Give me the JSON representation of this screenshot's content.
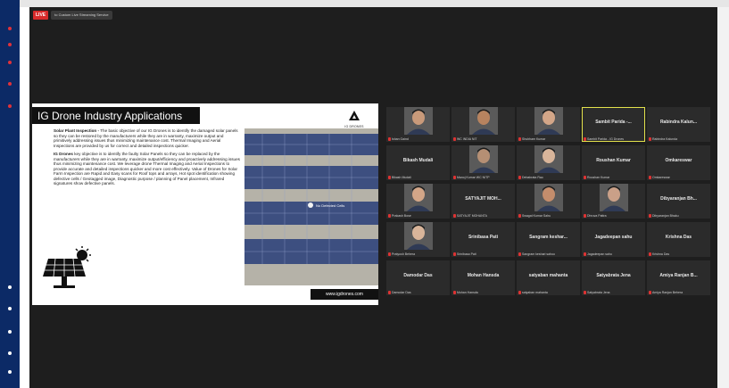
{
  "toolbar": {
    "live_badge": "LIVE",
    "stream_label": "to Custom Live Streaming Service"
  },
  "slide": {
    "title": "IG Drone Industry Applications",
    "logo_text": "IG DRONES",
    "para1_bold": "Solar Plant Inspection -",
    "para1_text": " The basic objective of our IG Drones is to identify the damaged solar panels so they can be restored by the manufacturers while they are in warranty, maximize output and primitively addressing issues thus minimizing maintenance cost. Thermal Imaging and Aerial Inspections are provided by us for correct and detailed inspections quicker.",
    "para2_bold": "IG Drones",
    "para2_text": " key objective is to identify the faulty Solar Panels so they can be replaced by the manufacturers while they are in warranty, maximize output/efficiency and proactively addressing issues thus minimizing maintenance cost. We leverage drone Thermal Imaging and Aerial Inspections to provide accurate and detailed inspections quicker and more cost effectively. Value of Drones for Solar Farm Inspection are Rapid and Easy scans for Roof tops and arrays, Hot spot identification showing defective cells / Geotagged image, Diagnostic purpose / planning of Panel placement, Infrared signatures show defective panels.",
    "image_caption": "No Defected Cells",
    "site_label": "www.igdrones.com"
  },
  "participants": [
    {
      "name": "",
      "label": "Ishan Gaind",
      "has_video": true
    },
    {
      "name": "",
      "label": "WC INDIA NIT",
      "has_video": true
    },
    {
      "name": "",
      "label": "Shubham Kumar",
      "has_video": true
    },
    {
      "name": "Sambit Parida -...",
      "label": "Sambit Parida - IG Drones",
      "has_video": false,
      "active": true
    },
    {
      "name": "Rabindra Kalun...",
      "label": "Rabindra Kalunda",
      "has_video": false
    },
    {
      "name": "Bikash Mudali",
      "label": "Bikash Mudali",
      "has_video": false
    },
    {
      "name": "",
      "label": "Manoj Kumar WC NITP",
      "has_video": true
    },
    {
      "name": "",
      "label": "Debabrata Rao",
      "has_video": true
    },
    {
      "name": "Roushan Kumar",
      "label": "Roushan Kumar",
      "has_video": false
    },
    {
      "name": "Omkareswar",
      "label": "Omkareswar",
      "has_video": false
    },
    {
      "name": "",
      "label": "Prakash Bose",
      "has_video": true
    },
    {
      "name": "SATYAJIT MOH...",
      "label": "SATYAJIT MOHANTA",
      "has_video": false
    },
    {
      "name": "",
      "label": "Swagat Kumar Sahu",
      "has_video": true
    },
    {
      "name": "",
      "label": "Dhruva Pattra",
      "has_video": true
    },
    {
      "name": "Dibyaranjan Bh...",
      "label": "Dibyaranjan Bhaku",
      "has_video": false
    },
    {
      "name": "",
      "label": "Pratyush Behera",
      "has_video": true
    },
    {
      "name": "Srinibasa Pati",
      "label": "Srinibasa Pati",
      "has_video": false
    },
    {
      "name": "Sangram keshar...",
      "label": "Sangram keshari sahoo",
      "has_video": false
    },
    {
      "name": "Jagadeepan sahu",
      "label": "Jagadeepan sahu",
      "has_video": false
    },
    {
      "name": "Krishna Das",
      "label": "Krishna Das",
      "has_video": false
    },
    {
      "name": "Damodar Das",
      "label": "Damodar Das",
      "has_video": false
    },
    {
      "name": "Mohan Hansda",
      "label": "Mohan Hansda",
      "has_video": false
    },
    {
      "name": "satyaban mahanta",
      "label": "satyaban mahanta",
      "has_video": false
    },
    {
      "name": "Satyabrata Jena",
      "label": "Satyabrata Jena",
      "has_video": false
    },
    {
      "name": "Amiya Ranjan B...",
      "label": "Amiya Ranjan Behera",
      "has_video": false
    }
  ],
  "colors": {
    "live": "#d72b2b",
    "active_speaker": "#e3e14c",
    "background": "#1e1e1e",
    "tile": "#2b2b2b"
  }
}
